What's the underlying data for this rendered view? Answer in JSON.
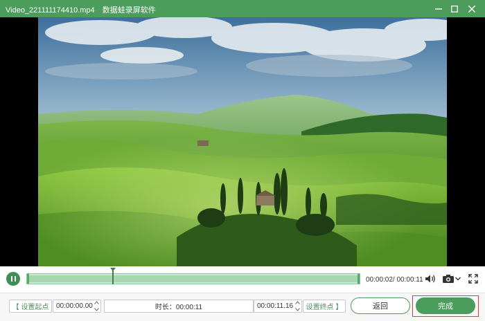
{
  "window": {
    "file_name": "Video_221111174410.mp4",
    "app_name": "数据蛙录屏软件",
    "controls": [
      "minimize-icon",
      "maximize-icon",
      "close-icon"
    ]
  },
  "player": {
    "state_icon": "pause-icon",
    "timecode": "00:00:02/ 00:00:11",
    "progress": 0.26,
    "icons": [
      "volume-icon",
      "camera-icon",
      "chevron-down-icon",
      "fullscreen-icon"
    ]
  },
  "trim": {
    "set_start_label": "【 设置起点",
    "start_value": "00:00:00.00",
    "duration_label": "时长：00:00:11",
    "end_value": "00:00:11.16",
    "set_end_label": "设置终点 】"
  },
  "actions": {
    "back_label": "返回",
    "done_label": "完成"
  },
  "colors": {
    "accent": "#4c9d5c",
    "highlight": "#e03c3c"
  }
}
